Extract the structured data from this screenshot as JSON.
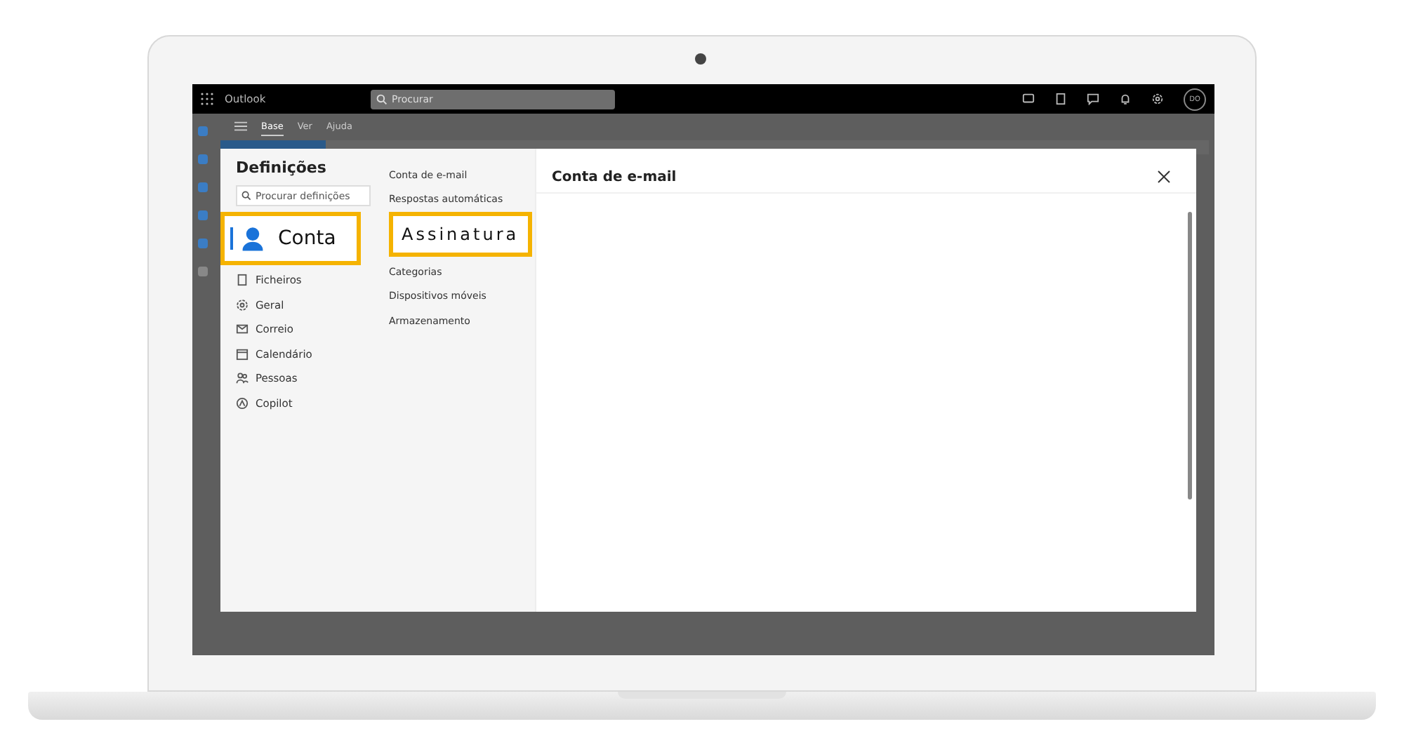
{
  "app": {
    "name": "Outlook",
    "search": {
      "placeholder": "Procurar"
    },
    "avatar": "DO",
    "ribbon_tabs": [
      {
        "label": "Base",
        "selected": true
      },
      {
        "label": "Ver",
        "selected": false
      },
      {
        "label": "Ajuda",
        "selected": false
      }
    ]
  },
  "settings": {
    "title": "Definições",
    "search": {
      "placeholder": "Procurar definições"
    },
    "categories": [
      {
        "label": "Conta",
        "selected": true,
        "highlighted": true
      },
      {
        "label": "Ficheiros",
        "selected": false,
        "highlighted": false
      },
      {
        "label": "Geral",
        "selected": false,
        "highlighted": false
      },
      {
        "label": "Correio",
        "selected": false,
        "highlighted": false
      },
      {
        "label": "Calendário",
        "selected": false,
        "highlighted": false
      },
      {
        "label": "Pessoas",
        "selected": false,
        "highlighted": false
      },
      {
        "label": "Copilot",
        "selected": false,
        "highlighted": false
      }
    ],
    "subcategories": [
      {
        "label": "Conta de e-mail",
        "highlighted": false
      },
      {
        "label": "Respostas automáticas",
        "highlighted": false
      },
      {
        "label": "Assinatura",
        "highlighted": true
      },
      {
        "label": "Categorias",
        "highlighted": false
      },
      {
        "label": "Dispositivos móveis",
        "highlighted": false
      },
      {
        "label": "Armazenamento",
        "highlighted": false
      }
    ],
    "content_title": "Conta de e-mail"
  }
}
